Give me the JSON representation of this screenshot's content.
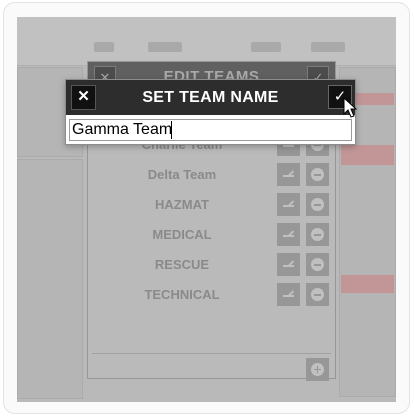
{
  "edit_teams": {
    "title": "EDIT TEAMS",
    "close_glyph": "✕",
    "ok_glyph": "✓",
    "teams": [
      "Charlie Team",
      "Delta Team",
      "HAZMAT",
      "MEDICAL",
      "RESCUE",
      "TECHNICAL"
    ],
    "add_icon": "plus-circle-icon"
  },
  "dialog": {
    "title": "SET TEAM NAME",
    "close_glyph": "✕",
    "ok_glyph": "✓",
    "input_value": "Gamma Team"
  },
  "colors": {
    "dialog_header": "#2d2d2d",
    "overlay": "#cfcfcf"
  }
}
